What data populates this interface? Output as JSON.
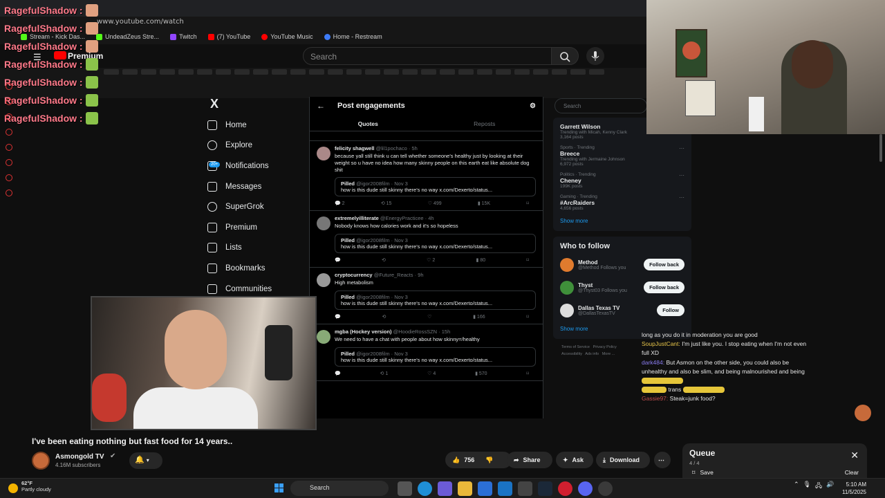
{
  "captured_browser": {
    "url": "www.youtube.com/watch",
    "bookmarks": [
      {
        "label": "Stream - Kick Das...",
        "color": "#53fc18"
      },
      {
        "label": "UndeadZeus Stre...",
        "color": "#53fc18"
      },
      {
        "label": "Twitch",
        "color": "#9146ff"
      },
      {
        "label": "(7) YouTube",
        "color": "#ff0000"
      },
      {
        "label": "YouTube Music",
        "color": "#ff0000"
      },
      {
        "label": "Home - Restream",
        "color": "#3d7bf7"
      }
    ],
    "youtube_logo": "Premium",
    "search_placeholder": "Search"
  },
  "chat_overlay": [
    {
      "user": "RagefulShadow :"
    },
    {
      "user": "RagefulShadow :"
    },
    {
      "user": "RagefulShadow :"
    },
    {
      "user": "RagefulShadow :"
    },
    {
      "user": "RagefulShadow :"
    },
    {
      "user": "RagefulShadow :"
    },
    {
      "user": "RagefulShadow :"
    }
  ],
  "x_app": {
    "logo": "X",
    "nav": [
      "Home",
      "Explore",
      "Notifications",
      "Messages",
      "SuperGrok",
      "Premium",
      "Lists",
      "Bookmarks",
      "Communities"
    ],
    "notif_badge": "20+",
    "header": "Post engagements",
    "tabs": [
      "Quotes",
      "Reposts"
    ],
    "tweets": [
      {
        "name": "felicity shagwell",
        "handle": "@lil1pochaco · 5h",
        "text": "because yall still think u can tell whether someone's healthy just by looking at their weight so u have no idea how many skinny people on this earth eat like absolute dog shit",
        "quote_name": "Pilled",
        "quote_handle": "@igor2008film · Nov 3",
        "quote_text": "how is this dude still skinny there's no way x.com/Dexerto/status...",
        "actions": [
          "2",
          "15",
          "499",
          "15K"
        ]
      },
      {
        "name": "extremelyilliterate",
        "handle": "@EnergyPracticee · 4h",
        "text": "Nobody knows how calories work and it's so hopeless",
        "quote_name": "Pilled",
        "quote_handle": "@igor2008film · Nov 3",
        "quote_text": "how is this dude still skinny there's no way x.com/Dexerto/status...",
        "actions": [
          "",
          "",
          "2",
          "80"
        ]
      },
      {
        "name": "cryptocurrency",
        "handle": "@Future_Reacts · 9h",
        "text": "High metabolism",
        "quote_name": "Pilled",
        "quote_handle": "@igor2008film · Nov 3",
        "quote_text": "how is this dude still skinny there's no way x.com/Dexerto/status...",
        "actions": [
          "",
          "",
          "",
          "166"
        ]
      },
      {
        "name": "mgba (Hockey version)",
        "handle": "@HoodieRossSZN · 15h",
        "text": "We need to have a chat with people about how skinny=/healthy",
        "quote_name": "Pilled",
        "quote_handle": "@igor2008film · Nov 3",
        "quote_text": "how is this dude still skinny there's no way x.com/Dexerto/status...",
        "actions": [
          "",
          "1",
          "4",
          "570"
        ]
      }
    ],
    "search_placeholder": "Search",
    "trends": [
      {
        "cat": "",
        "name": "Garrett Wilson",
        "count": "Trending with Micah, Kenny Clark",
        "extra": "3,164 posts"
      },
      {
        "cat": "Sports · Trending",
        "name": "Breece",
        "count": "Trending with Jermaine Johnson",
        "extra": "6,972 posts"
      },
      {
        "cat": "Politics · Trending",
        "name": "Cheney",
        "count": "199K posts",
        "extra": ""
      },
      {
        "cat": "Gaming · Trending",
        "name": "#ArcRaiders",
        "count": "4,656 posts",
        "extra": ""
      }
    ],
    "show_more": "Show more",
    "who_to_follow": "Who to follow",
    "follow": [
      {
        "name": "Method",
        "handle": "@Method",
        "tag": "Follows you",
        "btn": "Follow back"
      },
      {
        "name": "Thyst",
        "handle": "@Thyst03",
        "tag": "Follows you",
        "btn": "Follow back"
      },
      {
        "name": "Dallas Texas TV",
        "handle": "@DallasTexasTV",
        "tag": "",
        "btn": "Follow"
      }
    ],
    "footer": [
      "Terms of Service",
      "Privacy Policy",
      "Accessibility",
      "Ads info",
      "More ..."
    ]
  },
  "stream_chat": [
    {
      "user": "",
      "text": "long as you do it in moderation you are good"
    },
    {
      "user": "SoupJustCant:",
      "text": "I'm just like you. I stop eating when I'm not even full XD"
    },
    {
      "user": "dark484:",
      "text": "But Asmon on the other side, you could also be unhealthy and also be slim, and being malnourished and being"
    },
    {
      "user": "",
      "text": "trans"
    },
    {
      "user": "Gassie97:",
      "text": "Steak=junk food?"
    }
  ],
  "queue": {
    "title": "Queue",
    "count": "4 / 4",
    "save": "Save",
    "clear": "Clear"
  },
  "video": {
    "title": "I've been eating nothing but fast food for 14 years..",
    "channel": "Asmongold TV",
    "subscribers": "4.16M subscribers",
    "likes": "756",
    "share": "Share",
    "ask": "Ask",
    "download": "Download"
  },
  "taskbar": {
    "temp": "62°F",
    "weather": "Partly cloudy",
    "search": "Search",
    "time": "5:10 AM",
    "date": "11/5/2025"
  }
}
